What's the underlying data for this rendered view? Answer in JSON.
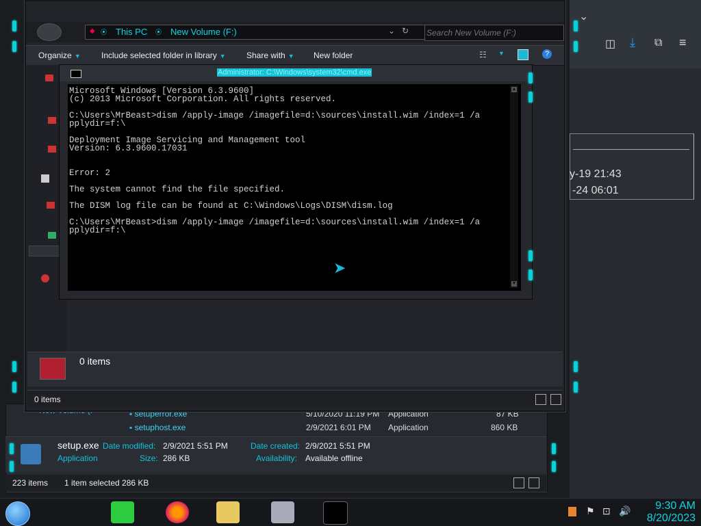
{
  "explorer": {
    "breadcrumb": [
      "This PC",
      "New Volume (F:)"
    ],
    "search_placeholder": "Search New Volume (F:)",
    "toolbar": {
      "organize": "Organize",
      "include_library": "Include selected folder in library",
      "share_with": "Share with",
      "new_folder": "New folder"
    },
    "details_text": "0 items",
    "status_text": "0 items"
  },
  "cmd": {
    "title": "Administrator: C:\\Windows\\system32\\cmd.exe",
    "lines": [
      "Microsoft Windows [Version 6.3.9600]",
      "(c) 2013 Microsoft Corporation. All rights reserved.",
      "",
      "C:\\Users\\MrBeast>dism /apply-image /imagefile=d:\\sources\\install.wim /index=1 /a",
      "pplydir=f:\\",
      "",
      "Deployment Image Servicing and Management tool",
      "Version: 6.3.9600.17031",
      "",
      "",
      "Error: 2",
      "",
      "The system cannot find the file specified.",
      "",
      "The DISM log file can be found at C:\\Windows\\Logs\\DISM\\dism.log",
      "",
      "C:\\Users\\MrBeast>dism /apply-image /imagefile=d:\\sources\\install.wim /index=1 /a",
      "pplydir=f:\\"
    ]
  },
  "bg_explorer": {
    "nav_partial": "New Volume (F",
    "files": [
      {
        "name": "setuperror.exe",
        "date": "5/10/2020 11:19 PM",
        "type": "Application",
        "size": "87 KB"
      },
      {
        "name": "setuphost.exe",
        "date": "2/9/2021 6:01 PM",
        "type": "Application",
        "size": "860 KB"
      }
    ],
    "details": {
      "file_name": "setup.exe",
      "file_type": "Application",
      "date_modified_label": "Date modified:",
      "date_modified": "2/9/2021 5:51 PM",
      "size_label": "Size:",
      "size": "286 KB",
      "date_created_label": "Date created:",
      "date_created": "2/9/2021 5:51 PM",
      "availability_label": "Availability:",
      "availability": "Available offline"
    },
    "status": {
      "items_count": "223 items",
      "selection": "1 item selected  286 KB"
    }
  },
  "bg_right": {
    "text1": "y-19 21:43",
    "text2": "-24 06:01"
  },
  "taskbar": {
    "time": "9:30 AM",
    "date": "8/20/2023"
  },
  "colors": {
    "accent": "#0bd0da",
    "cmd_title_bg": "#15c3d4"
  }
}
